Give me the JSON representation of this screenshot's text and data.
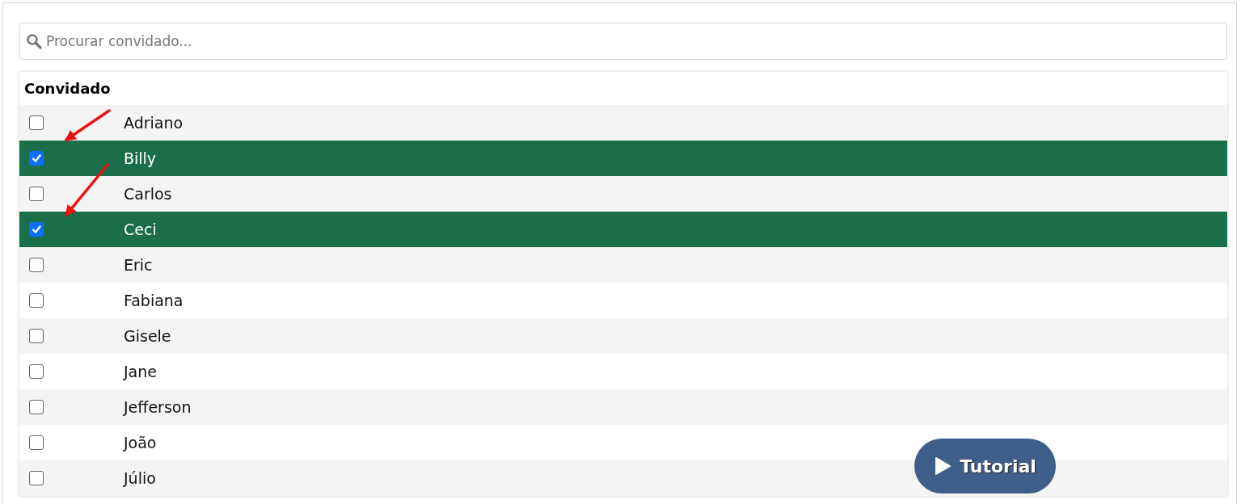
{
  "search": {
    "placeholder": "Procurar convidado..."
  },
  "table": {
    "columns": [
      "Convidado"
    ],
    "rows": [
      {
        "name": "Adriano",
        "checked": false
      },
      {
        "name": "Billy",
        "checked": true
      },
      {
        "name": "Carlos",
        "checked": false
      },
      {
        "name": "Ceci",
        "checked": true
      },
      {
        "name": "Eric",
        "checked": false
      },
      {
        "name": "Fabiana",
        "checked": false
      },
      {
        "name": "Gisele",
        "checked": false
      },
      {
        "name": "Jane",
        "checked": false
      },
      {
        "name": "Jefferson",
        "checked": false
      },
      {
        "name": "João",
        "checked": false
      },
      {
        "name": "Júlio",
        "checked": false
      }
    ]
  },
  "tutorial_button": {
    "label": "Tutorial"
  }
}
